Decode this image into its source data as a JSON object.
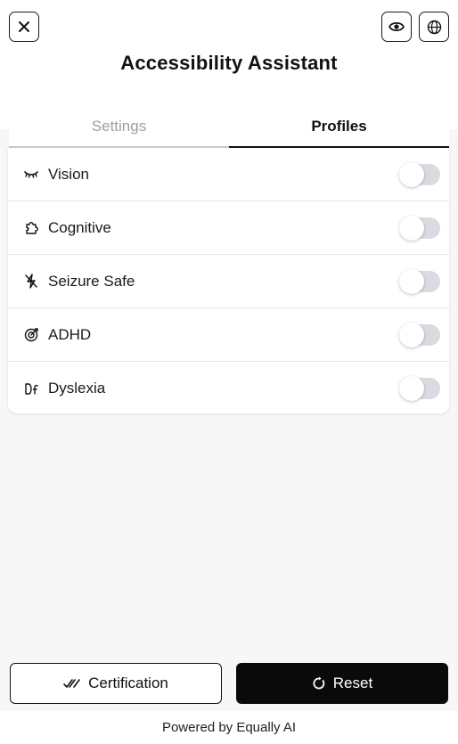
{
  "header": {
    "title": "Accessibility Assistant",
    "close_icon": "close-icon",
    "eye_icon": "eye-icon",
    "globe_icon": "globe-icon"
  },
  "tabs": [
    {
      "label": "Settings",
      "active": false
    },
    {
      "label": "Profiles",
      "active": true
    }
  ],
  "profiles": [
    {
      "label": "Vision",
      "icon": "closed-eye-icon",
      "enabled": false
    },
    {
      "label": "Cognitive",
      "icon": "puzzle-icon",
      "enabled": false
    },
    {
      "label": "Seizure Safe",
      "icon": "lightning-off-icon",
      "enabled": false
    },
    {
      "label": "ADHD",
      "icon": "target-icon",
      "enabled": false
    },
    {
      "label": "Dyslexia",
      "icon": "dyslexia-icon",
      "enabled": false
    }
  ],
  "actions": {
    "certification_label": "Certification",
    "reset_label": "Reset"
  },
  "footer": {
    "powered_by": "Powered by Equally AI"
  },
  "colors": {
    "primary": "#0a0a0a",
    "inactive_tab": "#9a9fa6",
    "toggle_off": "#d9dbe0",
    "panel_bg": "#f7f7f7"
  }
}
